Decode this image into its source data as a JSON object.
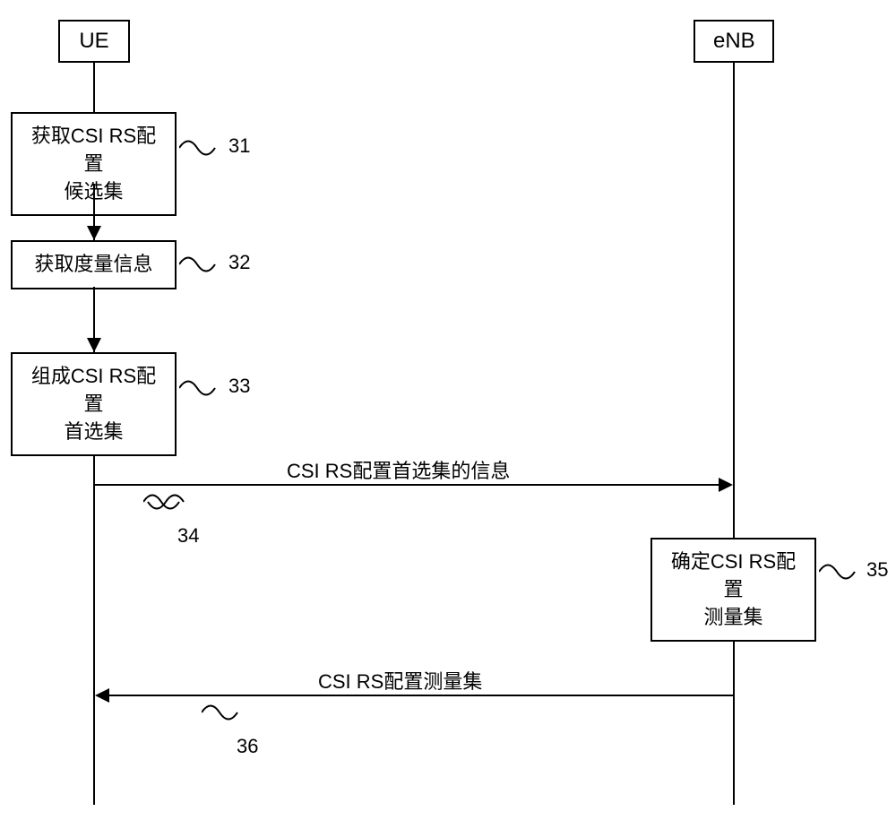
{
  "actors": {
    "ue": "UE",
    "enb": "eNB"
  },
  "steps": {
    "s31": {
      "text": "获取CSI RS配置\n候选集",
      "label": "31"
    },
    "s32": {
      "text": "获取度量信息",
      "label": "32"
    },
    "s33": {
      "text": "组成CSI RS配置\n首选集",
      "label": "33"
    },
    "s35": {
      "text": "确定CSI RS配置\n测量集",
      "label": "35"
    }
  },
  "messages": {
    "m34": {
      "text": "CSI RS配置首选集的信息",
      "label": "34"
    },
    "m36": {
      "text": "CSI RS配置测量集",
      "label": "36"
    }
  }
}
